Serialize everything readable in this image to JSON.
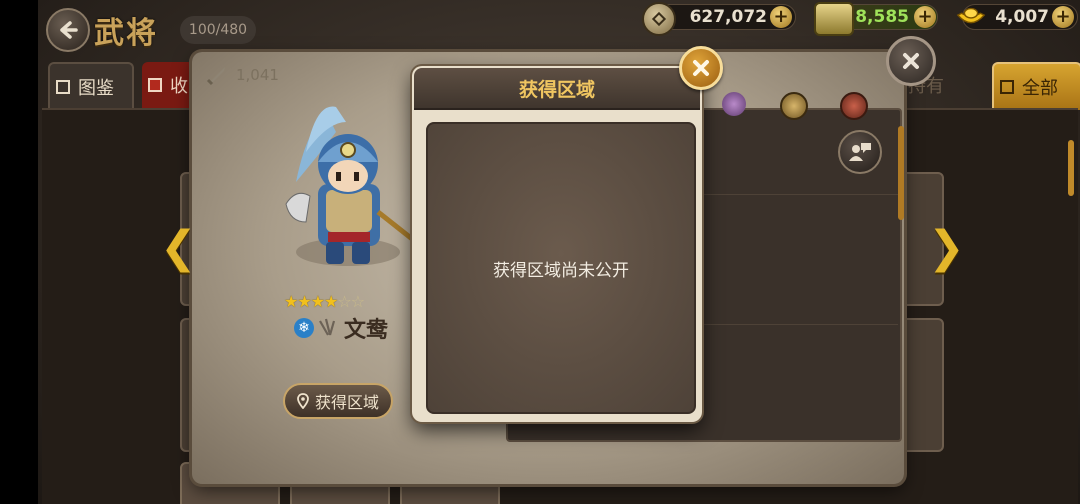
{
  "header": {
    "title": "武将",
    "hero_count": "100/480"
  },
  "resources": {
    "coins": "627,072",
    "gold_bars": "8,585",
    "ingots": "4,007"
  },
  "tabs": {
    "dex": "图鉴",
    "favorites": "收",
    "owned": "持有",
    "all": "全部"
  },
  "hero": {
    "power": "1,041",
    "name": "文鸯",
    "stars_filled": 4,
    "stars_total": 6,
    "acquire_button": "获得区域"
  },
  "modal": {
    "title": "获得区域",
    "message": "获得区域尚未公开"
  },
  "colors": {
    "accent_gold": "#f0c661",
    "nav_arrow": "#e3b62a",
    "modal_close": "#e0a53a"
  }
}
